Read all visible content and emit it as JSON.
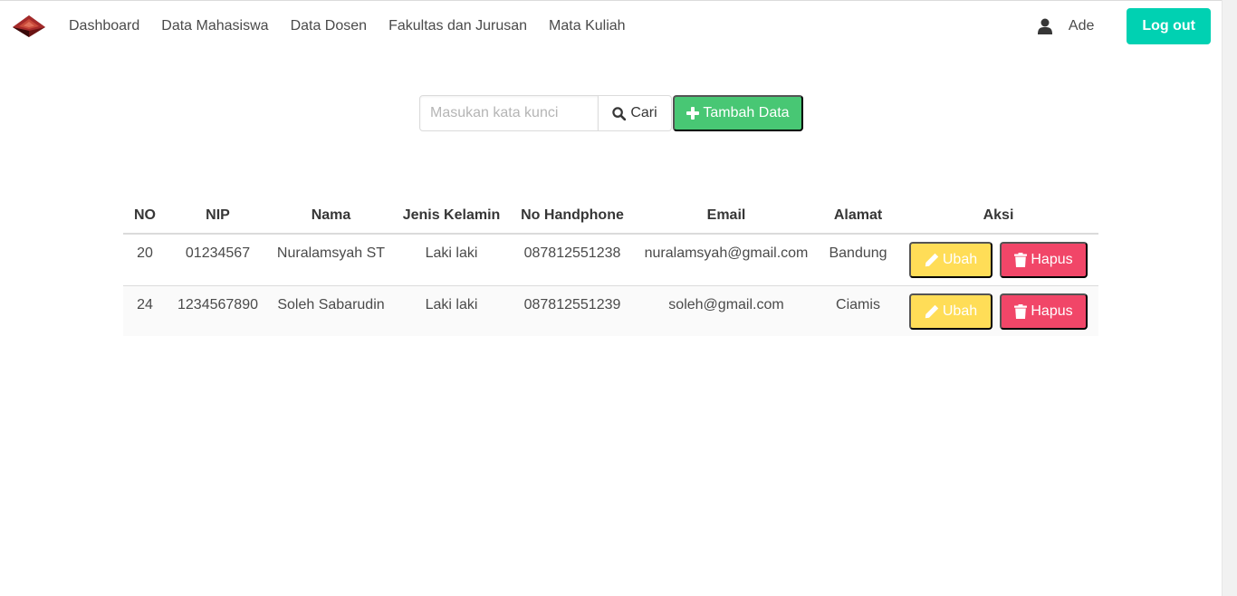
{
  "nav": {
    "items": [
      {
        "label": "Dashboard"
      },
      {
        "label": "Data Mahasiswa"
      },
      {
        "label": "Data Dosen"
      },
      {
        "label": "Fakultas dan Jurusan"
      },
      {
        "label": "Mata Kuliah"
      }
    ],
    "user_name": "Ade",
    "logout_label": "Log out"
  },
  "search": {
    "placeholder": "Masukan kata kunci",
    "value": "",
    "button_label": "Cari",
    "add_label": "Tambah Data"
  },
  "table": {
    "headers": [
      "NO",
      "NIP",
      "Nama",
      "Jenis Kelamin",
      "No Handphone",
      "Email",
      "Alamat",
      "Aksi"
    ],
    "rows": [
      {
        "no": "20",
        "nip": "01234567",
        "nama": "Nuralamsyah ST",
        "jk": "Laki laki",
        "hp": "087812551238",
        "email": "nuralamsyah@gmail.com",
        "alamat": "Bandung",
        "edit": "Ubah",
        "delete": "Hapus"
      },
      {
        "no": "24",
        "nip": "1234567890",
        "nama": "Soleh Sabarudin",
        "jk": "Laki laki",
        "hp": "087812551239",
        "email": "soleh@gmail.com",
        "alamat": "Ciamis",
        "edit": "Ubah",
        "delete": "Hapus"
      }
    ]
  },
  "colors": {
    "primary": "#00d1b2",
    "success": "#48c774",
    "warning": "#ffdd57",
    "danger": "#f14668"
  },
  "icons": {
    "brand": "pyramid-logo-icon",
    "user": "user-icon",
    "search": "search-icon",
    "add": "plus-icon",
    "edit": "pencil-icon",
    "delete": "trash-icon"
  }
}
